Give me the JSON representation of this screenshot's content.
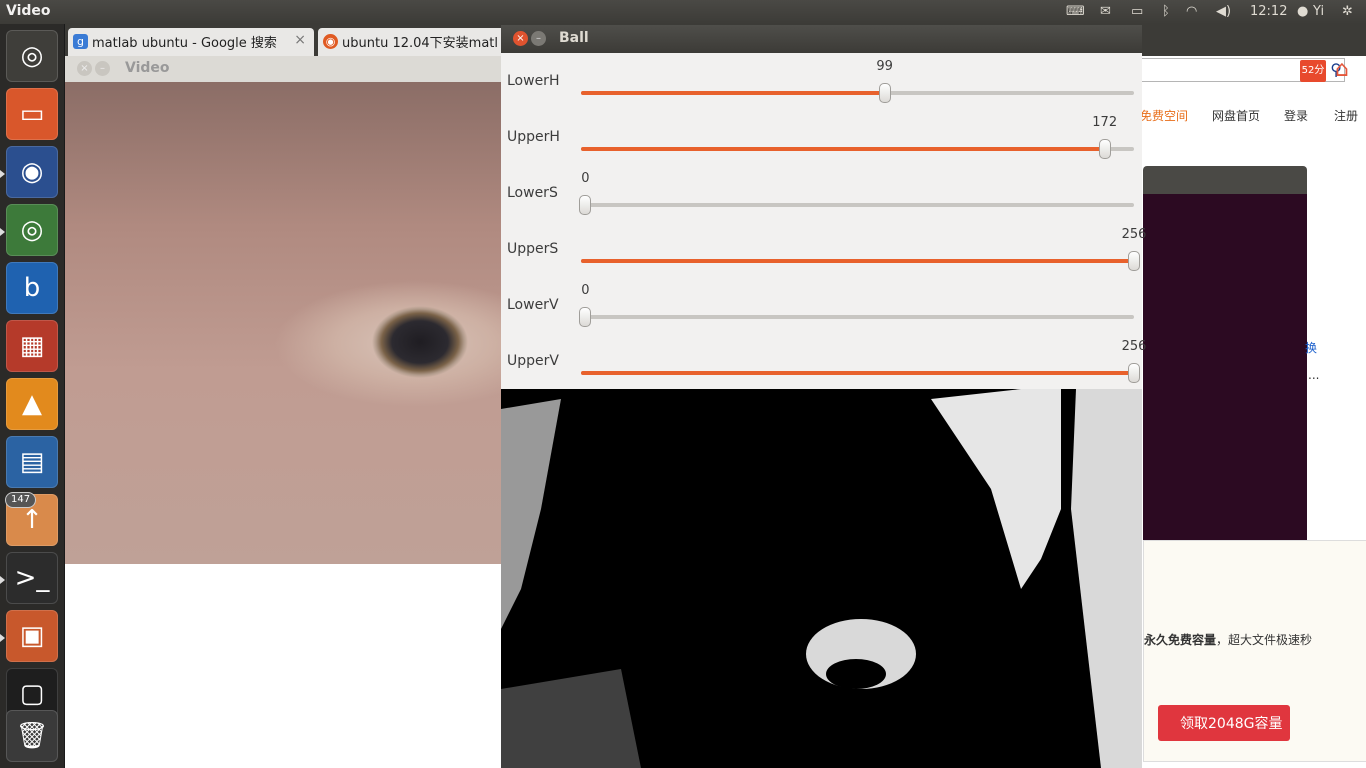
{
  "top_panel": {
    "title": "Video",
    "time": "12:12",
    "user": "Yi",
    "icons": [
      "keyboard-icon",
      "mail-icon",
      "battery-icon",
      "bluetooth-icon",
      "wifi-icon",
      "volume-icon",
      "user-icon",
      "session-gear-icon"
    ]
  },
  "launcher": {
    "items": [
      "ubuntu-dash",
      "files",
      "firefox",
      "chrome",
      "bible",
      "apps",
      "vlc",
      "libreoffice-writer",
      "update-manager",
      "terminal",
      "video-player",
      "workspace-switcher",
      "trash"
    ],
    "update_count": "147"
  },
  "browser": {
    "tabs": [
      {
        "label": "matlab ubuntu - Google 搜索",
        "close": "×"
      },
      {
        "label": "ubuntu 12.04下安装matl"
      }
    ],
    "score": "52分",
    "nav": [
      "免费空间",
      "网盘首页",
      "登录",
      "注册"
    ],
    "side_text_1": "换",
    "side_text_2": "...",
    "popup": {
      "close": "×",
      "text_bold": "永久免费容量",
      "text_rest": "，超大文件极速秒",
      "button": "领取2048G容量"
    }
  },
  "video_window": {
    "title": "Video"
  },
  "ball_window": {
    "title": "Ball",
    "trackbars": [
      {
        "label": "LowerH",
        "value": "99",
        "fraction": 0.549
      },
      {
        "label": "UpperH",
        "value": "172",
        "fraction": 0.947
      },
      {
        "label": "LowerS",
        "value": "0",
        "fraction": 0.008
      },
      {
        "label": "UpperS",
        "value": "256",
        "fraction": 1.0
      },
      {
        "label": "LowerV",
        "value": "0",
        "fraction": 0.008
      },
      {
        "label": "UpperV",
        "value": "256",
        "fraction": 1.0
      }
    ]
  }
}
